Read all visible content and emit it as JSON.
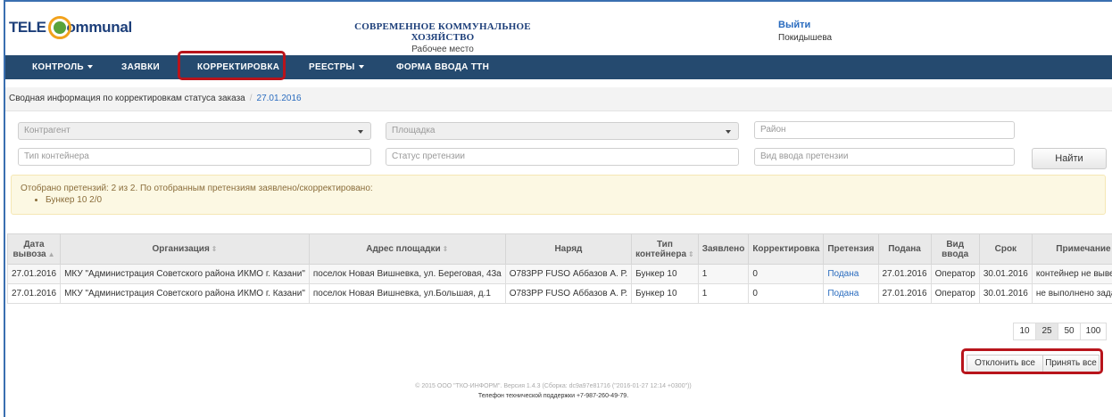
{
  "header": {
    "logo_tele": "TELE",
    "logo_communal": "ommunal",
    "title": "СОВРЕМЕННОЕ КОММУНАЛЬНОЕ ХОЗЯЙСТВО",
    "subtitle": "Рабочее место",
    "logout": "Выйти",
    "user": "Покидышева"
  },
  "nav": {
    "items": [
      {
        "label": "Контроль",
        "dropdown": true
      },
      {
        "label": "Заявки",
        "dropdown": false
      },
      {
        "label": "Корректировка",
        "dropdown": false
      },
      {
        "label": "Реестры",
        "dropdown": true
      },
      {
        "label": "Форма ввода ТТН",
        "dropdown": false
      }
    ],
    "bg_color": "#254a6f",
    "highlight_color": "#b8141b"
  },
  "breadcrumb": {
    "page": "Сводная информация по корректировкам статуса заказа",
    "date": "27.01.2016"
  },
  "filters": {
    "kontragent": "Контрагент",
    "ploshchadka": "Площадка",
    "raion": "Район",
    "tip_konteinera": "Тип контейнера",
    "status_pretenzii": "Статус претензии",
    "vid_vvoda": "Вид ввода претензии",
    "find_button": "Найти"
  },
  "alert": {
    "text": "Отобрано претензий: 2 из 2. По отобранным претензиям заявлено/скорректировано:",
    "item": "Бункер 10 2/0"
  },
  "table": {
    "headers": [
      "Дата вывоза",
      "Организация",
      "Адрес площадки",
      "Наряд",
      "Тип контейнера",
      "Заявлено",
      "Корректировка",
      "Претензия",
      "Подана",
      "Вид ввода",
      "Срок",
      "Примечание"
    ],
    "rows": [
      [
        "27.01.2016",
        "МКУ \"Администрация Советского района ИКМО г. Казани\"",
        "поселок Новая Вишневка, ул. Береговая, 43а",
        "О783РР FUSO Аббазов А. Р.",
        "Бункер 10",
        "1",
        "0",
        "Подана",
        "27.01.2016",
        "Оператор",
        "30.01.2016",
        "контейнер не вывезен"
      ],
      [
        "27.01.2016",
        "МКУ \"Администрация Советского района ИКМО г. Казани\"",
        "поселок Новая Вишневка, ул.Большая, д.1",
        "О783РР FUSO Аббазов А. Р.",
        "Бункер 10",
        "1",
        "0",
        "Подана",
        "27.01.2016",
        "Оператор",
        "30.01.2016",
        "не выполнено задание"
      ]
    ]
  },
  "pager": {
    "sizes": [
      "10",
      "25",
      "50",
      "100"
    ],
    "active": "25"
  },
  "actions": {
    "reject_all": "Отклонить все",
    "accept_all": "Принять все"
  },
  "footer": {
    "line1": "© 2015 ООО \"ТКО-ИНФОРМ\". Версия 1.4.3 (Сборка: dc9a97e81716 (\"2016-01-27 12:14 +0300\"))",
    "line2": "Телефон технической поддержки +7-987-260-49-79."
  }
}
